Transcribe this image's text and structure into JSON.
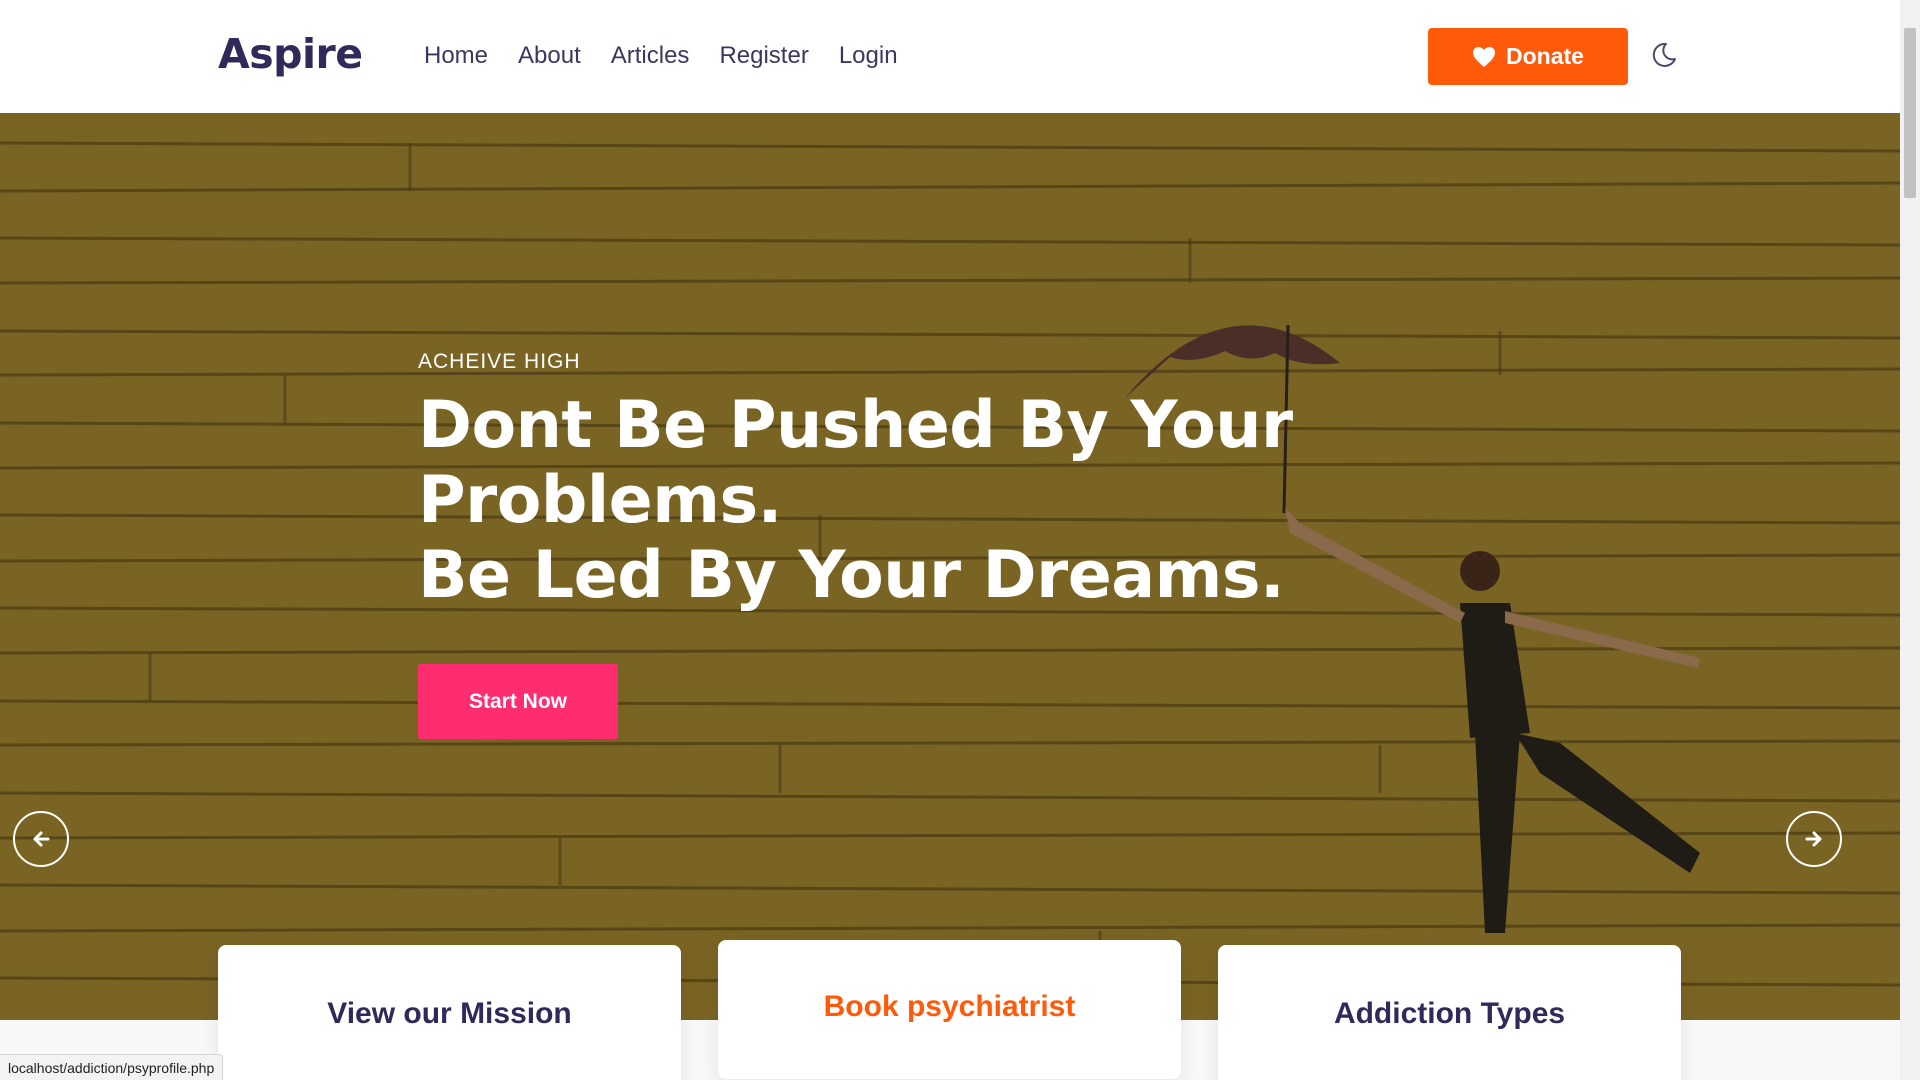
{
  "header": {
    "logo": "Aspire",
    "nav": [
      "Home",
      "About",
      "Articles",
      "Register",
      "Login"
    ],
    "donate_label": "Donate",
    "donate_icon": "heart-icon",
    "theme_icon": "moon-icon"
  },
  "hero": {
    "kicker": "ACHEIVE HIGH",
    "title_line1": "Dont Be Pushed By Your",
    "title_line2": "Problems.",
    "title_line3": "Be Led By Your Dreams.",
    "cta_label": "Start Now",
    "prev_icon": "arrow-left-icon",
    "next_icon": "arrow-right-icon"
  },
  "cards": [
    {
      "label": "View our Mission"
    },
    {
      "label": "Book psychiatrist"
    },
    {
      "label": "Addiction Types"
    }
  ],
  "status_url": "localhost/addiction/psyprofile.php",
  "colors": {
    "brand": "#2f2a5a",
    "donate": "#ff5a0a",
    "cta": "#ff2d6f",
    "hero_overlay": "#7a6424"
  }
}
